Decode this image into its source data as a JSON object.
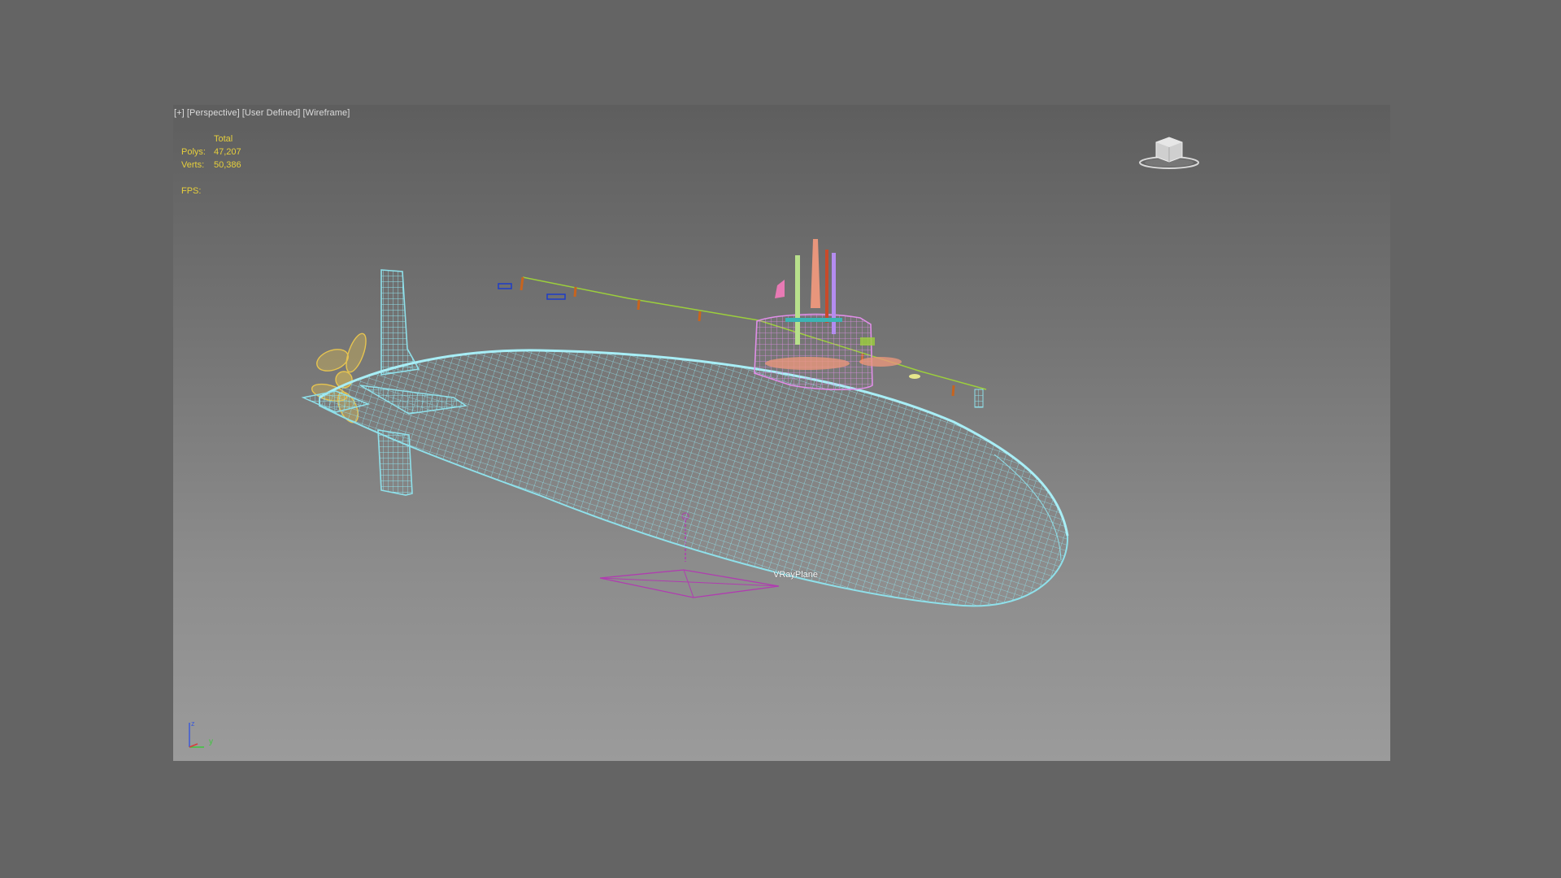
{
  "viewport": {
    "label_plus": "[+]",
    "label_view": "[Perspective]",
    "label_camera": "[User Defined]",
    "label_mode": "[Wireframe]"
  },
  "stats": {
    "header": "Total",
    "polys_label": "Polys:",
    "polys_value": "47,207",
    "verts_label": "Verts:",
    "verts_value": "50,386",
    "fps_label": "FPS:"
  },
  "scene": {
    "object_label": "VRayPlane"
  },
  "axis": {
    "z": "z",
    "y": "y"
  },
  "colors": {
    "hull": "#8fe0ea",
    "sail": "#e08ee8",
    "propeller": "#e6c450",
    "plane": "#b03cb0",
    "guardrail": "#9ccf3c",
    "stanchion": "#c8641e",
    "stats_text": "#e6cf3c"
  },
  "icons": [
    "viewcube-icon",
    "axis-tripod-icon"
  ]
}
